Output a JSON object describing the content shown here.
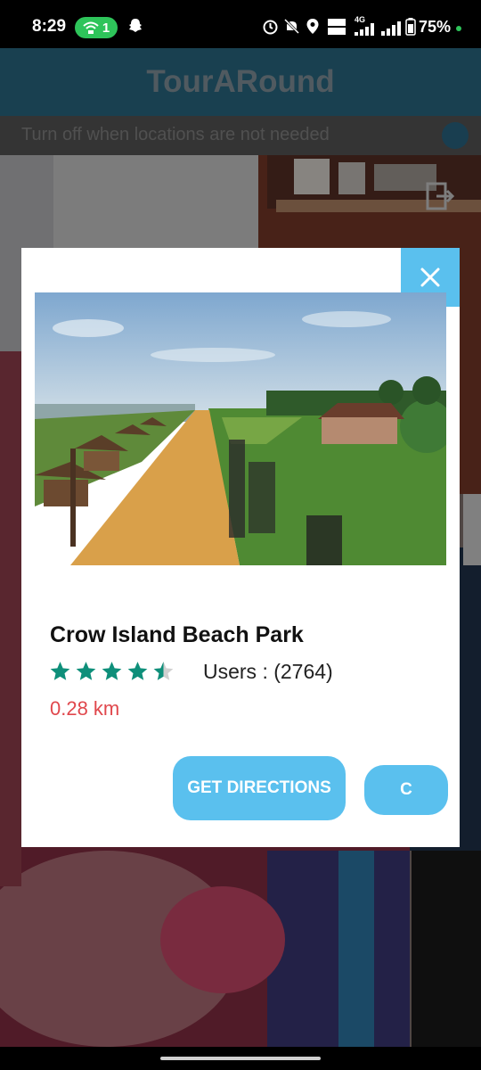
{
  "status_bar": {
    "time": "8:29",
    "hotspot_count": "1",
    "network_label": "4G",
    "battery": "75%"
  },
  "app": {
    "title": "TourARound",
    "toggle_label": "Turn off when locations are not needed"
  },
  "dialog": {
    "place_name": "Crow Island Beach Park",
    "rating": 4.5,
    "users_text": "Users : (2764)",
    "distance": "0.28 km",
    "directions_label": "GET DIRECTIONS",
    "c_label": "C",
    "close_icon": "close-icon"
  },
  "colors": {
    "accent": "#5ac0ee",
    "app_bar": "#2b6f8a",
    "star": "#0e8f7a",
    "distance": "#e0474c"
  }
}
